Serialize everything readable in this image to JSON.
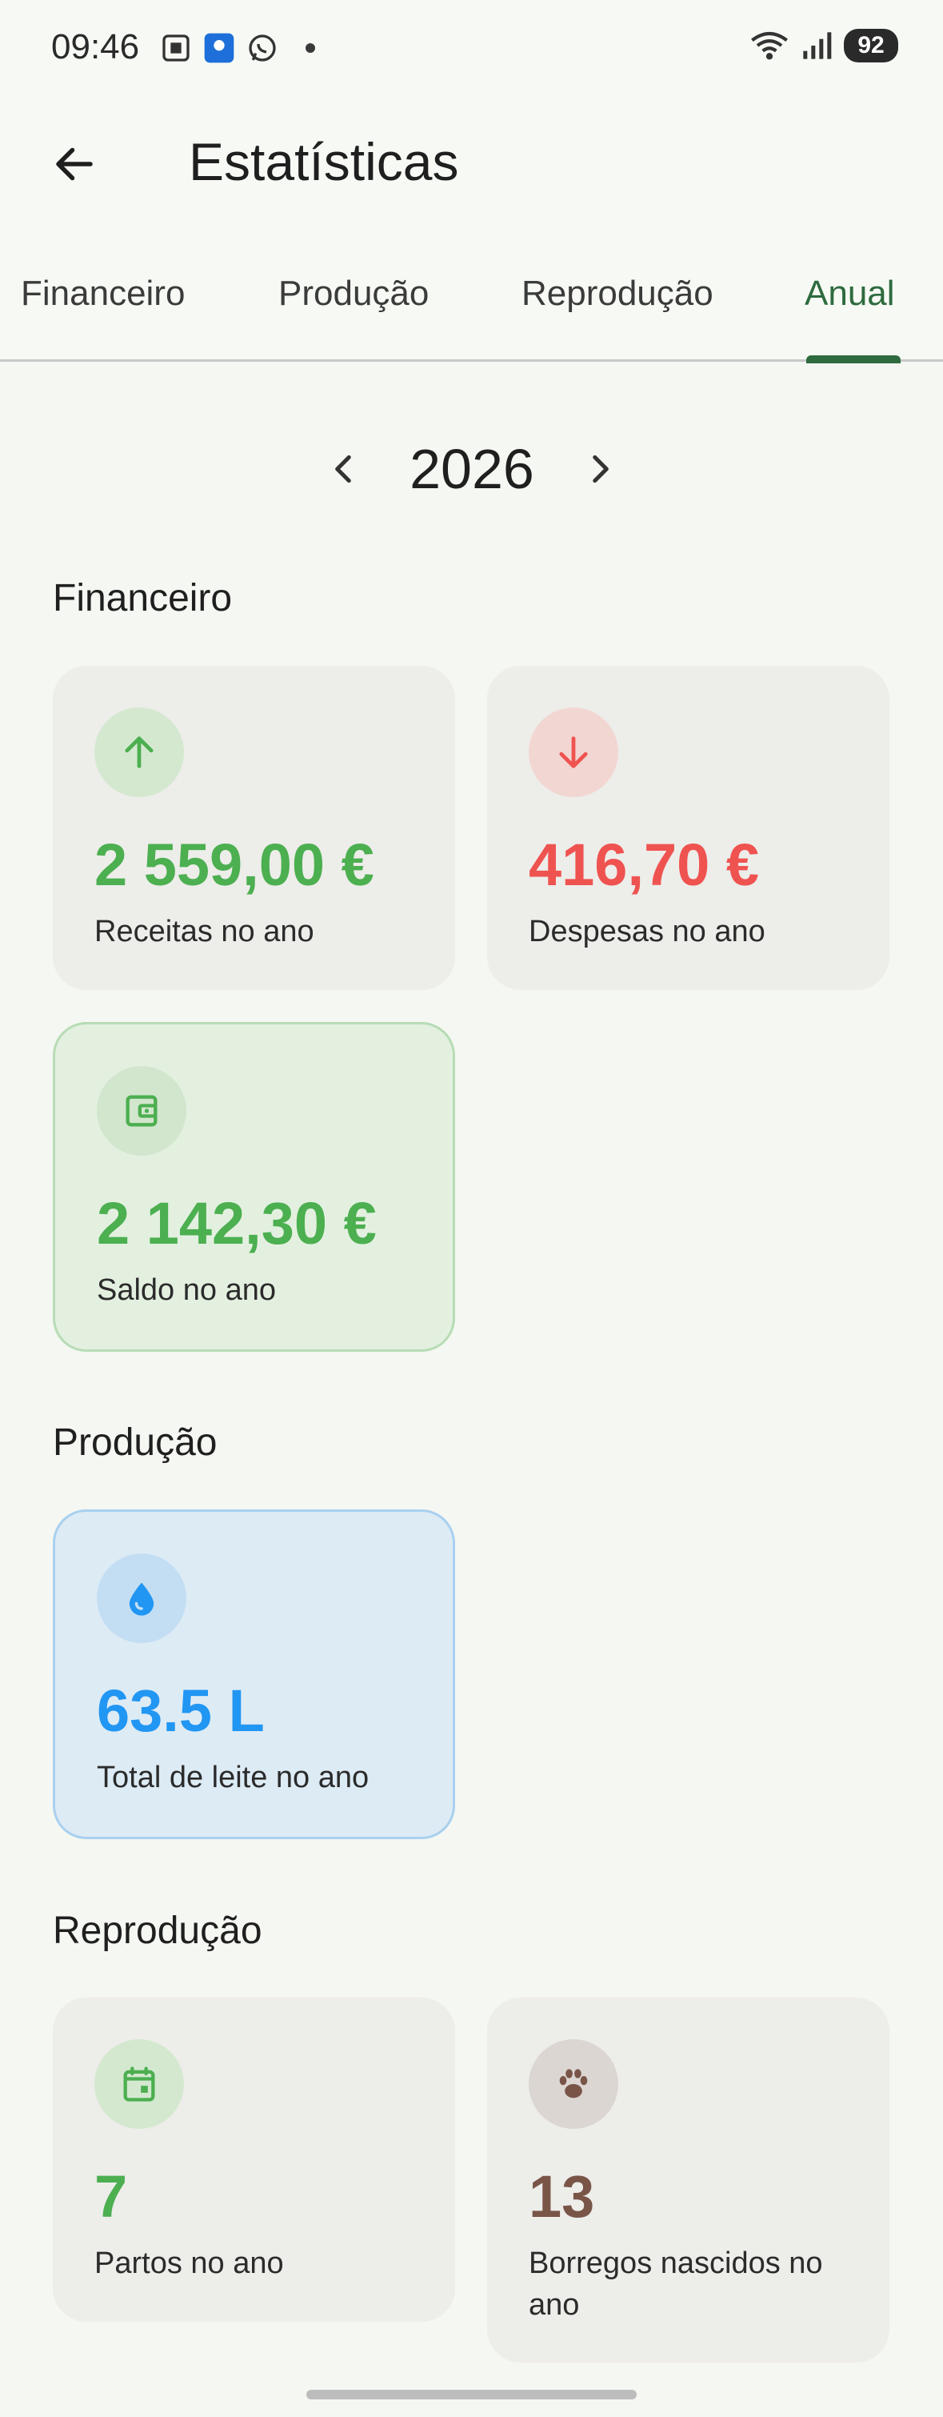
{
  "status_bar": {
    "time": "09:46",
    "battery": "92"
  },
  "app_bar": {
    "title": "Estatísticas"
  },
  "tabs": [
    {
      "label": "Financeiro"
    },
    {
      "label": "Produção"
    },
    {
      "label": "Reprodução"
    },
    {
      "label": "Anual"
    }
  ],
  "active_tab": "Anual",
  "year": "2026",
  "sections": {
    "financeiro": {
      "title": "Financeiro",
      "cards": [
        {
          "value": "2 559,00 €",
          "label": "Receitas no ano",
          "icon": "arrow-up-icon",
          "color": "#4caf50"
        },
        {
          "value": "416,70 €",
          "label": "Despesas no ano",
          "icon": "arrow-down-icon",
          "color": "#ef5350"
        },
        {
          "value": "2 142,30 €",
          "label": "Saldo no ano",
          "icon": "wallet-icon",
          "color": "#4caf50"
        }
      ]
    },
    "producao": {
      "title": "Produção",
      "cards": [
        {
          "value": "63.5 L",
          "label": "Total de leite no ano",
          "icon": "water-drop-icon",
          "color": "#2196f3"
        }
      ]
    },
    "reproducao": {
      "title": "Reprodução",
      "cards": [
        {
          "value": "7",
          "label": "Partos no ano",
          "icon": "calendar-icon",
          "color": "#4caf50"
        },
        {
          "value": "13",
          "label": "Borregos nascidos no ano",
          "icon": "paw-icon",
          "color": "#795548"
        }
      ]
    }
  },
  "colors": {
    "primary": "#2e6b3f",
    "income": "#4caf50",
    "expense": "#ef5350",
    "milk": "#2196f3",
    "lambs": "#795548"
  }
}
